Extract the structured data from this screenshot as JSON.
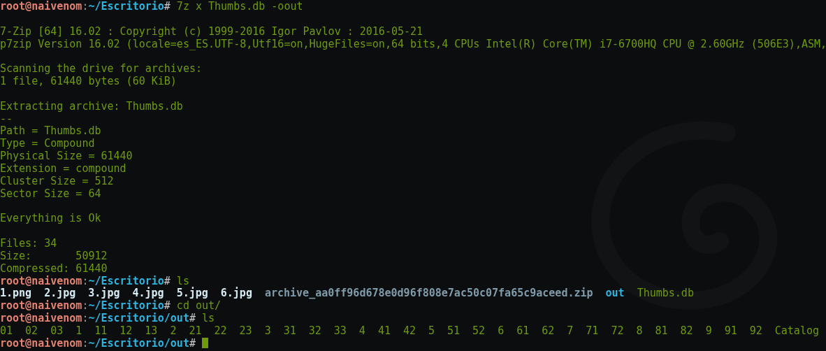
{
  "terminal": {
    "lines": [
      {
        "kind": "prompt",
        "user": "root@naivenom",
        "separator": ":",
        "path": "~/Escritorio",
        "symbol": "#",
        "command": "7z x Thumbs.db -oout",
        "cursor": false
      },
      {
        "kind": "blank"
      },
      {
        "kind": "output",
        "text": "7-Zip [64] 16.02 : Copyright (c) 1999-2016 Igor Pavlov : 2016-05-21"
      },
      {
        "kind": "output",
        "text": "p7zip Version 16.02 (locale=es_ES.UTF-8,Utf16=on,HugeFiles=on,64 bits,4 CPUs Intel(R) Core(TM) i7-6700HQ CPU @ 2.60GHz (506E3),ASM,"
      },
      {
        "kind": "blank"
      },
      {
        "kind": "output",
        "text": "Scanning the drive for archives:"
      },
      {
        "kind": "output",
        "text": "1 file, 61440 bytes (60 KiB)"
      },
      {
        "kind": "blank"
      },
      {
        "kind": "output",
        "text": "Extracting archive: Thumbs.db"
      },
      {
        "kind": "output",
        "text": "--"
      },
      {
        "kind": "output",
        "text": "Path = Thumbs.db"
      },
      {
        "kind": "output",
        "text": "Type = Compound"
      },
      {
        "kind": "output",
        "text": "Physical Size = 61440"
      },
      {
        "kind": "output",
        "text": "Extension = compound"
      },
      {
        "kind": "output",
        "text": "Cluster Size = 512"
      },
      {
        "kind": "output",
        "text": "Sector Size = 64"
      },
      {
        "kind": "blank"
      },
      {
        "kind": "output",
        "text": "Everything is Ok"
      },
      {
        "kind": "blank"
      },
      {
        "kind": "output",
        "text": "Files: 34"
      },
      {
        "kind": "output",
        "text": "Size:       50912"
      },
      {
        "kind": "output",
        "text": "Compressed: 61440"
      },
      {
        "kind": "prompt",
        "user": "root@naivenom",
        "separator": ":",
        "path": "~/Escritorio",
        "symbol": "#",
        "command": "ls",
        "cursor": false
      },
      {
        "kind": "listing",
        "entries": [
          {
            "name": "1.png",
            "kind": "image"
          },
          {
            "name": "2.jpg",
            "kind": "image"
          },
          {
            "name": "3.jpg",
            "kind": "image"
          },
          {
            "name": "4.jpg",
            "kind": "image"
          },
          {
            "name": "5.jpg",
            "kind": "image"
          },
          {
            "name": "6.jpg",
            "kind": "image"
          },
          {
            "name": "archive_aa0ff96d678e0d96f808e7ac50c07fa65c9aceed.zip",
            "kind": "archive"
          },
          {
            "name": "out",
            "kind": "directory"
          },
          {
            "name": "Thumbs.db",
            "kind": "file"
          }
        ]
      },
      {
        "kind": "prompt",
        "user": "root@naivenom",
        "separator": ":",
        "path": "~/Escritorio",
        "symbol": "#",
        "command": "cd out/",
        "cursor": false
      },
      {
        "kind": "prompt",
        "user": "root@naivenom",
        "separator": ":",
        "path": "~/Escritorio/out",
        "symbol": "#",
        "command": "ls",
        "cursor": false
      },
      {
        "kind": "listing",
        "entries": [
          {
            "name": "01",
            "kind": "file"
          },
          {
            "name": "02",
            "kind": "file"
          },
          {
            "name": "03",
            "kind": "file"
          },
          {
            "name": "1",
            "kind": "file"
          },
          {
            "name": "11",
            "kind": "file"
          },
          {
            "name": "12",
            "kind": "file"
          },
          {
            "name": "13",
            "kind": "file"
          },
          {
            "name": "2",
            "kind": "file"
          },
          {
            "name": "21",
            "kind": "file"
          },
          {
            "name": "22",
            "kind": "file"
          },
          {
            "name": "23",
            "kind": "file"
          },
          {
            "name": "3",
            "kind": "file"
          },
          {
            "name": "31",
            "kind": "file"
          },
          {
            "name": "32",
            "kind": "file"
          },
          {
            "name": "33",
            "kind": "file"
          },
          {
            "name": "4",
            "kind": "file"
          },
          {
            "name": "41",
            "kind": "file"
          },
          {
            "name": "42",
            "kind": "file"
          },
          {
            "name": "5",
            "kind": "file"
          },
          {
            "name": "51",
            "kind": "file"
          },
          {
            "name": "52",
            "kind": "file"
          },
          {
            "name": "6",
            "kind": "file"
          },
          {
            "name": "61",
            "kind": "file"
          },
          {
            "name": "62",
            "kind": "file"
          },
          {
            "name": "7",
            "kind": "file"
          },
          {
            "name": "71",
            "kind": "file"
          },
          {
            "name": "72",
            "kind": "file"
          },
          {
            "name": "8",
            "kind": "file"
          },
          {
            "name": "81",
            "kind": "file"
          },
          {
            "name": "82",
            "kind": "file"
          },
          {
            "name": "9",
            "kind": "file"
          },
          {
            "name": "91",
            "kind": "file"
          },
          {
            "name": "92",
            "kind": "file"
          },
          {
            "name": "Catalog",
            "kind": "file"
          }
        ]
      },
      {
        "kind": "prompt",
        "user": "root@naivenom",
        "separator": ":",
        "path": "~/Escritorio/out",
        "symbol": "#",
        "cursor": true
      }
    ]
  }
}
